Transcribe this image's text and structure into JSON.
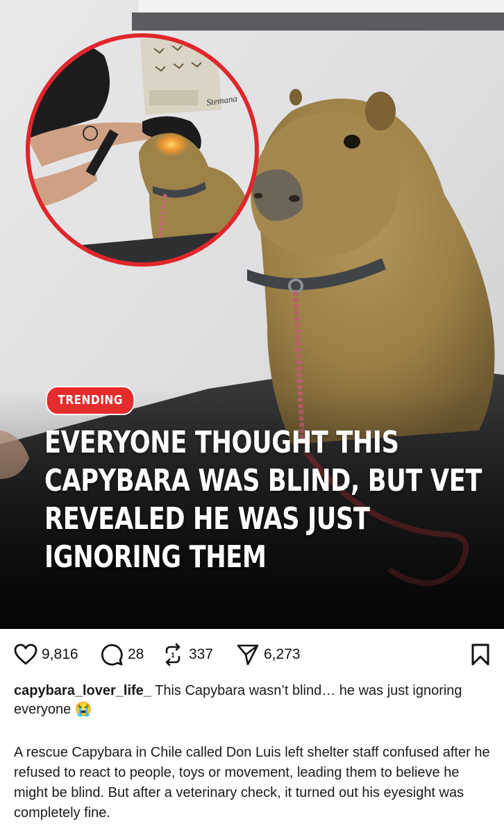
{
  "post": {
    "badge": "TRENDING",
    "headline_lines": [
      "EVERYONE THOUGHT THIS",
      "CAPYBARA WAS BLIND, BUT VET",
      "REVEALED HE WAS JUST",
      "IGNORING THEM"
    ],
    "inset_sign": "Stemana"
  },
  "actions": {
    "likes": "9,816",
    "comments": "28",
    "reposts": "337",
    "shares": "6,273"
  },
  "caption": {
    "username": "capybara_lover_life_",
    "text": "This Capybara wasn’t blind… he was just ignoring everyone",
    "emoji": "😭"
  },
  "description": "A rescue Capybara in Chile called Don Luis left shelter staff confused after he refused to react to people, toys or movement, leading them to believe he might be blind. But after a veterinary check, it turned out his eyesight was completely fine.",
  "colors": {
    "badge": "#e52b2b",
    "inset_ring": "#e0262a",
    "capybara_fur": "#a0834a"
  }
}
